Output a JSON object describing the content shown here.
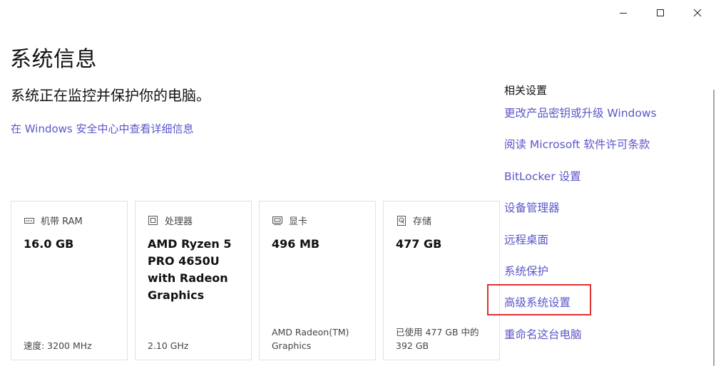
{
  "window": {
    "minimize_glyph": "—",
    "maximize_glyph": "☐",
    "close_glyph": "✕"
  },
  "page": {
    "title": "系统信息",
    "subtitle": "系统正在监控并保护你的电脑。",
    "security_link": "在 Windows 安全中心中查看详细信息"
  },
  "cards": [
    {
      "icon": "ram-icon",
      "label": "机带 RAM",
      "value": "16.0 GB",
      "footer": "速度: 3200 MHz"
    },
    {
      "icon": "processor-icon",
      "label": "处理器",
      "value": "AMD Ryzen 5 PRO 4650U with Radeon Graphics",
      "footer": "2.10 GHz"
    },
    {
      "icon": "display-adapter-icon",
      "label": "显卡",
      "value": "496 MB",
      "footer": "AMD Radeon(TM) Graphics"
    },
    {
      "icon": "storage-icon",
      "label": "存储",
      "value": "477 GB",
      "footer": "已使用 477 GB 中的 392 GB"
    }
  ],
  "related": {
    "title": "相关设置",
    "items": [
      "更改产品密钥或升级 Windows",
      "阅读 Microsoft 软件许可条款",
      "BitLocker 设置",
      "设备管理器",
      "远程桌面",
      "系统保护",
      "高级系统设置",
      "重命名这台电脑"
    ],
    "highlighted_item": "高级系统设置"
  },
  "colors": {
    "link": "#5b56c9",
    "highlight_border": "#e0312f",
    "card_border": "#e2e2e2"
  }
}
